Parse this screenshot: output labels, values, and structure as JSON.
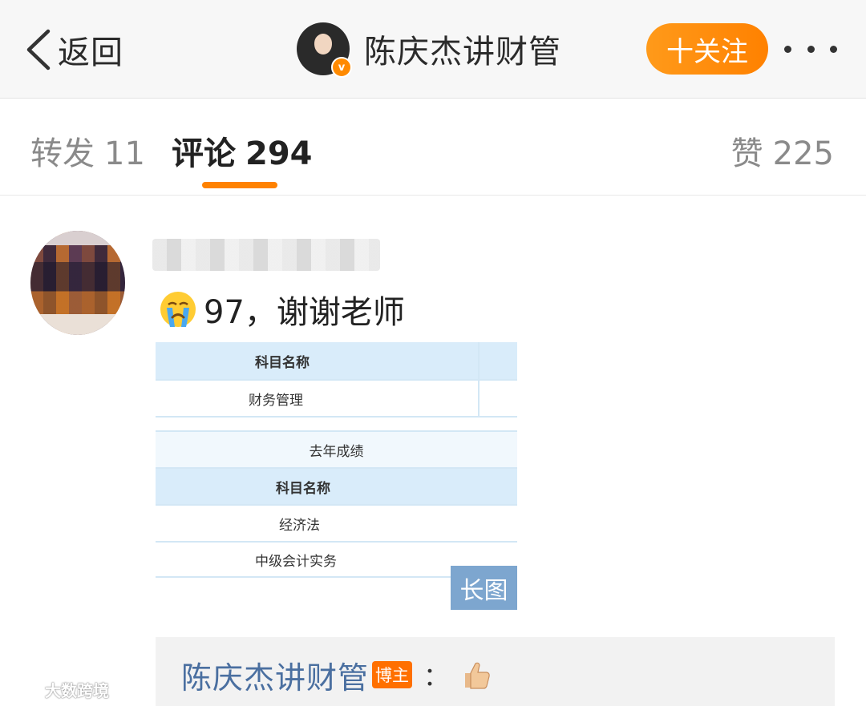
{
  "header": {
    "back_label": "返回",
    "author_name": "陈庆杰讲财管",
    "verify_mark": "v",
    "follow_label": "十关注"
  },
  "tabs": {
    "repost": {
      "label": "转发",
      "count": "11"
    },
    "comment": {
      "label": "评论",
      "count": "294"
    },
    "like": {
      "label": "赞",
      "count": "225"
    },
    "accent": "#ff8200"
  },
  "comment": {
    "text": "97，谢谢老师",
    "emoji": "crying-face",
    "attachment": {
      "table1_header": "科目名称",
      "table1_row": "财务管理",
      "table2_title": "去年成绩",
      "table2_header": "科目名称",
      "table2_rows": [
        "经济法",
        "中级会计实务"
      ],
      "badge": "长图"
    }
  },
  "reply": {
    "author": "陈庆杰讲财管",
    "badge": "博主",
    "colon": "：",
    "emoji": "thumbs-up"
  },
  "watermark": {
    "text": "大数跨境"
  }
}
